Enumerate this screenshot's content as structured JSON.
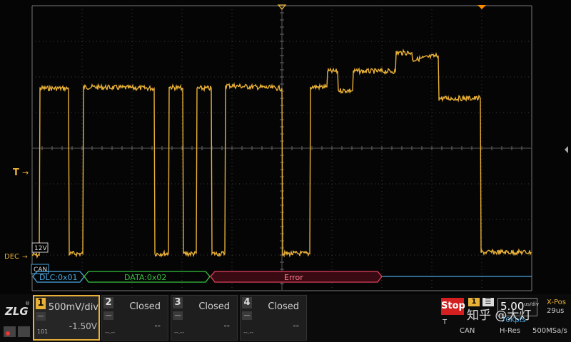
{
  "trigger_label": "T",
  "decode_label": "DEC",
  "threshold_label": "12V",
  "bus_type_tag": "CAN",
  "decode_segments": [
    {
      "label": "DLC:0x01",
      "color": "#4aa8e0"
    },
    {
      "label": "DATA:0x02",
      "color": "#36c43e"
    },
    {
      "label": "Error",
      "color": "#e04060"
    }
  ],
  "channels": [
    {
      "num": "1",
      "state": "500mV/div",
      "offset": "-1.50V",
      "coupling": "—",
      "bw": "101",
      "active": true
    },
    {
      "num": "2",
      "state": "Closed",
      "offset": "--",
      "coupling": "—",
      "bw": "--.--"
    },
    {
      "num": "3",
      "state": "Closed",
      "offset": "--",
      "coupling": "—",
      "bw": "--.--"
    },
    {
      "num": "4",
      "state": "Closed",
      "offset": "--",
      "coupling": "—",
      "bw": "--.--"
    }
  ],
  "acq": {
    "run_state": "Stop",
    "trig_source": "1",
    "trig_mode": "T",
    "trig_type": "CAN",
    "timebase": "5.00",
    "timebase_unit": "us/div",
    "mode": "H-Res",
    "memory": "70Kpts",
    "sample_rate": "500MSa/s",
    "xpos_label": "X-Pos",
    "xpos_value": "29us"
  },
  "watermark": "知乎 @大灯",
  "colors": {
    "ch1": "#e8b037",
    "grid": "#4a4a4a",
    "stop": "#d31f1f"
  }
}
